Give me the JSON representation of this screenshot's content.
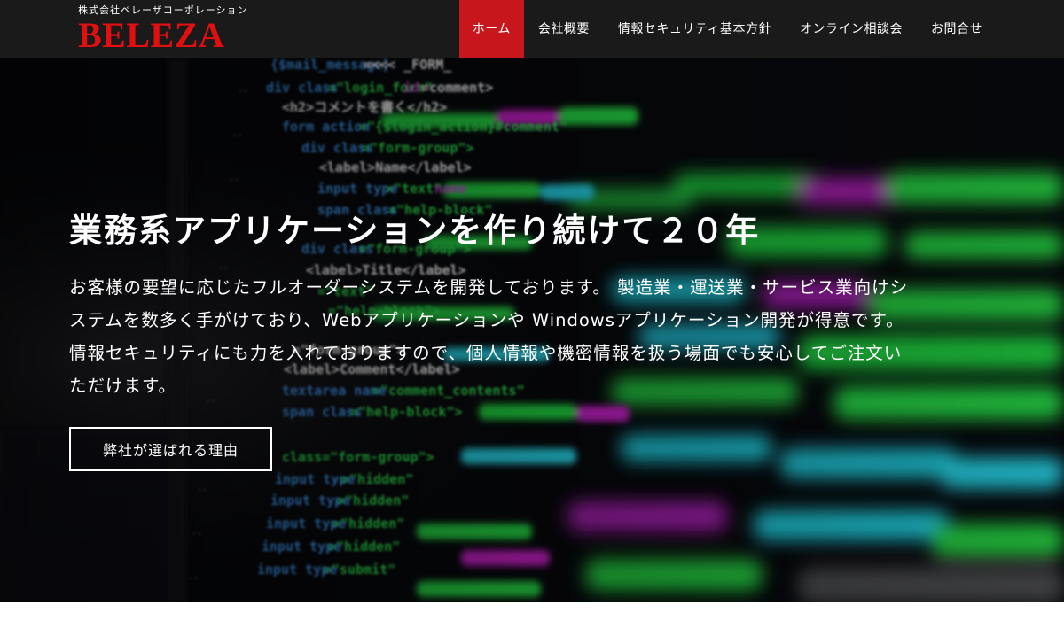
{
  "brand": {
    "company_name": "株式会社ベレーザコーポレーション",
    "logo_text": "BELEZA",
    "accent_color": "#c8161d",
    "logo_color": "#e01010"
  },
  "nav": {
    "items": [
      {
        "label": "ホーム",
        "active": true
      },
      {
        "label": "会社概要",
        "active": false
      },
      {
        "label": "情報セキュリティ基本方針",
        "active": false
      },
      {
        "label": "オンライン相談会",
        "active": false
      },
      {
        "label": "お問合せ",
        "active": false
      }
    ]
  },
  "hero": {
    "title": "業務系アプリケーションを作り続けて２０年",
    "description_lines": [
      "お客様の要望に応じたフルオーダーシステムを開発しております。 製造業・運送業・サービス業向けシ",
      "ステムを数多く手がけており、Webアプリケーションや Windowsアプリケーション開発が得意です。",
      "情報セキュリティにも力を入れておりますので、個人情報や機密情報を扱う場面でも安心してご注文い",
      "ただけます。"
    ],
    "cta_label": "弊社が選ばれる理由",
    "background": "code-editor-photo"
  }
}
